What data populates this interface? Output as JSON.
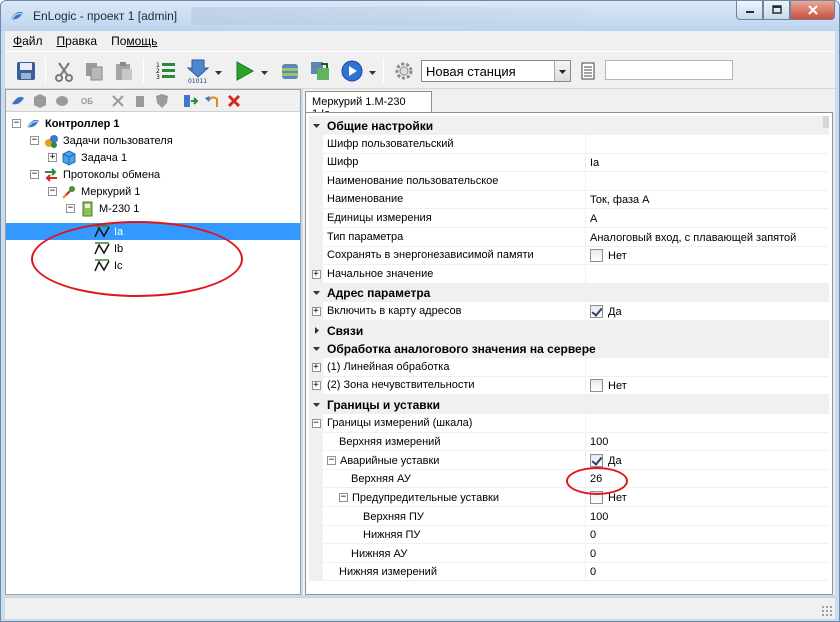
{
  "window": {
    "title": "EnLogic - проект 1 [admin]"
  },
  "menu": [
    {
      "key": "Ф",
      "rest": "айл"
    },
    {
      "key": "П",
      "rest": "равка"
    },
    {
      "key": "По",
      "rest": "мощь"
    }
  ],
  "toolbar": {
    "station_select": "Новая станция",
    "icons": [
      "save-icon",
      "cut-icon",
      "copy-icon",
      "paste-icon",
      "numbered-list-icon",
      "download-binary-icon",
      "run-icon",
      "database-icon",
      "sync-icon",
      "play-circle-icon",
      "gear-icon",
      "document-icon"
    ]
  },
  "left_toolbar": {
    "icons": [
      "connect-icon",
      "cube-icon",
      "cylinder-icon",
      "ob-icon",
      "disconnect-icon",
      "delete-icon",
      "shield-icon",
      "import-icon",
      "undo-icon",
      "remove-red-icon"
    ],
    "ob_label": "ОБ"
  },
  "tree": {
    "items": [
      {
        "label": "Контроллер 1",
        "level": 0,
        "expander": "−",
        "bold": true
      },
      {
        "label": "Задачи пользователя",
        "level": 1,
        "expander": "−"
      },
      {
        "label": "Задача 1",
        "level": 2,
        "expander": "+"
      },
      {
        "label": "Протоколы обмена",
        "level": 1,
        "expander": "−"
      },
      {
        "label": "Меркурий 1",
        "level": 2,
        "expander": "−"
      },
      {
        "label": "М-230 1",
        "level": 3,
        "expander": "−"
      },
      {
        "label": "Ia",
        "level": 4,
        "selected": true
      },
      {
        "label": "Ib",
        "level": 4
      },
      {
        "label": "Ic",
        "level": 4
      }
    ]
  },
  "properties": {
    "tab": "Меркурий 1.М-230 1.Ia",
    "rows": [
      {
        "type": "cat",
        "name": "Общие настройки",
        "open": true
      },
      {
        "name": "Шифр пользовательский",
        "value": ""
      },
      {
        "name": "Шифр",
        "value": "Ia"
      },
      {
        "name": "Наименование пользовательское",
        "value": ""
      },
      {
        "name": "Наименование",
        "value": "Ток, фаза А"
      },
      {
        "name": "Единицы измерения",
        "value": "А"
      },
      {
        "name": "Тип параметра",
        "value": "Аналоговый вход, с плавающей запятой"
      },
      {
        "name": "Сохранять в энергонезависимой памяти",
        "value": "Нет",
        "check": false
      },
      {
        "name": "Начальное значение",
        "value": "",
        "expander": "+"
      },
      {
        "type": "cat",
        "name": "Адрес параметра",
        "open": true
      },
      {
        "name": "Включить в карту адресов",
        "value": "Да",
        "check": true,
        "expander": "+"
      },
      {
        "type": "cat",
        "name": "Связи",
        "open": false
      },
      {
        "type": "cat",
        "name": "Обработка аналогового значения на сервере",
        "open": true
      },
      {
        "name": "(1) Линейная обработка",
        "value": "",
        "expander": "+"
      },
      {
        "name": "(2) Зона нечувствительности",
        "value": "Нет",
        "check": false,
        "expander": "+"
      },
      {
        "type": "cat",
        "name": "Границы и уставки",
        "open": true
      },
      {
        "name": "Границы измерений (шкала)",
        "value": "",
        "expander": "−",
        "indent": 0
      },
      {
        "name": "Верхняя измерений",
        "value": "100",
        "indent": 1
      },
      {
        "name": "Аварийные уставки",
        "value": "Да",
        "check": true,
        "expander": "−",
        "indent": 1
      },
      {
        "name": "Верхняя АУ",
        "value": "26",
        "indent": 2
      },
      {
        "name": "Предупредительные уставки",
        "value": "Нет",
        "check": false,
        "expander": "−",
        "indent": 2
      },
      {
        "name": "Верхняя ПУ",
        "value": "100",
        "indent": 3
      },
      {
        "name": "Нижняя ПУ",
        "value": "0",
        "indent": 3
      },
      {
        "name": "Нижняя АУ",
        "value": "0",
        "indent": 2
      },
      {
        "name": "Нижняя измерений",
        "value": "0",
        "indent": 1
      }
    ]
  },
  "annotation_color": "#e0141e"
}
